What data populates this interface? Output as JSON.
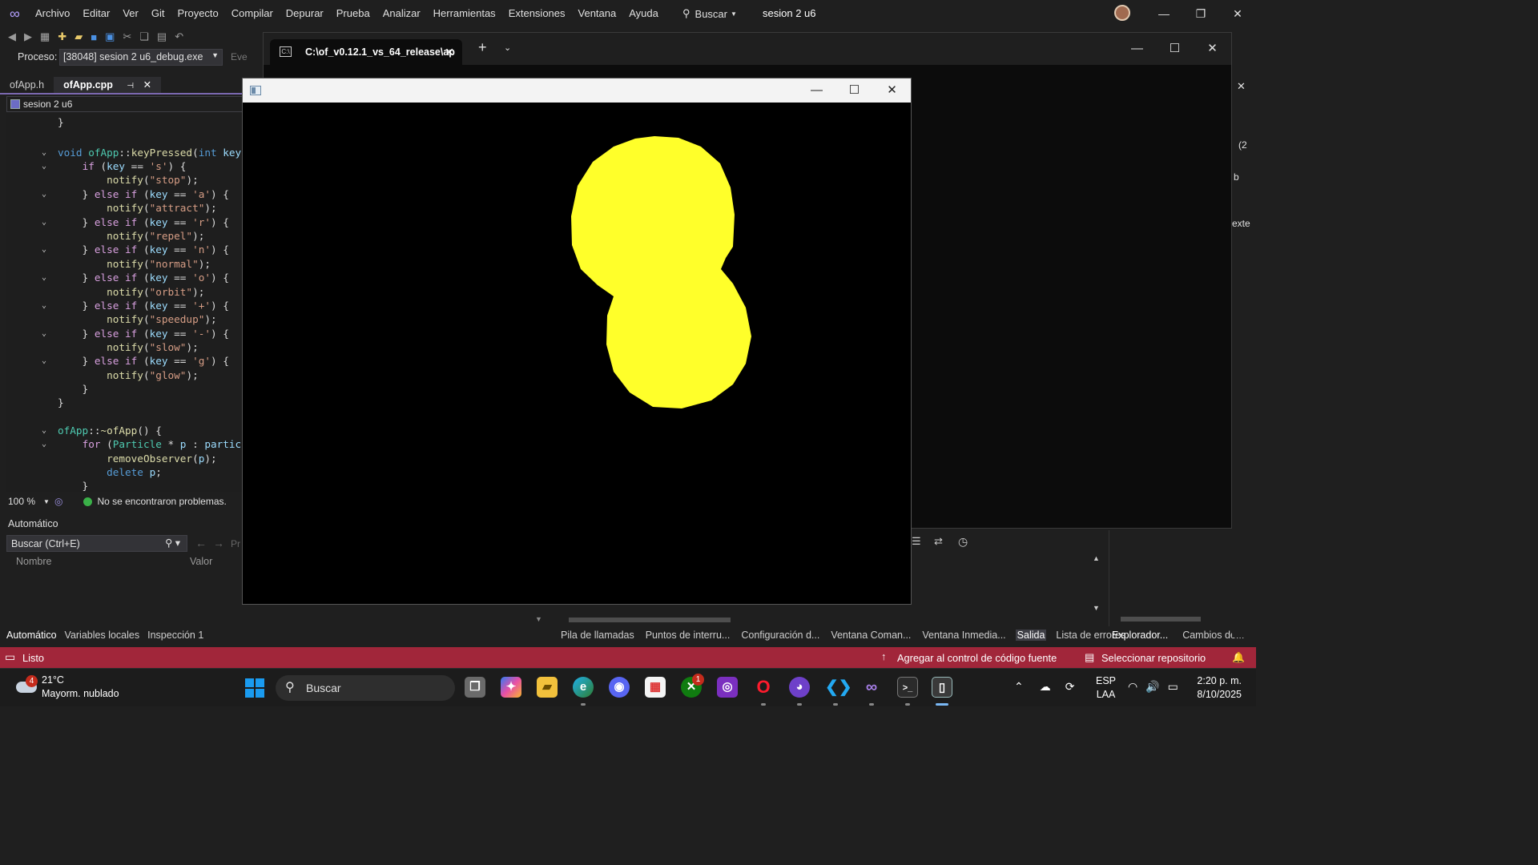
{
  "vs": {
    "menu": [
      "Archivo",
      "Editar",
      "Ver",
      "Git",
      "Proyecto",
      "Compilar",
      "Depurar",
      "Prueba",
      "Analizar",
      "Herramientas",
      "Extensiones",
      "Ventana",
      "Ayuda"
    ],
    "search_label": "Buscar",
    "solution_title": "sesion 2 u6",
    "process_label": "Proceso:",
    "process_value": "[38048] sesion 2 u6_debug.exe",
    "events_label": "Eve",
    "tabs": [
      {
        "label": "ofApp.h"
      },
      {
        "label": "ofApp.cpp"
      }
    ],
    "nav_dropdown": "sesion 2 u6",
    "zoom": "100 %",
    "problems": "No se encontraron problemas.",
    "auto_panel": {
      "title": "Automático",
      "search_placeholder": "Buscar (Ctrl+E)",
      "col_name": "Nombre",
      "col_value": "Valor",
      "pr_label": "Pr"
    },
    "bottom_tabs_left": [
      "Automático",
      "Variables locales",
      "Inspección 1"
    ],
    "bottom_tabs_right": [
      "Pila de llamadas",
      "Puntos de interru...",
      "Configuración d...",
      "Ventana Coman...",
      "Ventana Inmedia...",
      "Salida",
      "Lista de errores"
    ],
    "bottom_tabs_far": [
      "Explorador...",
      "Cambios de..."
    ],
    "status": {
      "ready": "Listo",
      "git": "Agregar al control de código fuente",
      "repo": "Seleccionar repositorio"
    },
    "right_panel": {
      "frag1": "(2",
      "frag2": "b",
      "frag3": "exte"
    }
  },
  "terminal": {
    "tab_title": "C:\\of_v0.12.1_vs_64_release\\ap"
  },
  "app_window": {
    "accent_fill": "#ffff2a"
  },
  "taskbar": {
    "weather_temp": "21°C",
    "weather_desc": "Mayorm. nublado",
    "weather_badge": "4",
    "search": "Buscar",
    "xbox_badge": "1",
    "lang1": "ESP",
    "lang2": "LAA",
    "time": "2:20 p. m.",
    "date": "8/10/2025"
  }
}
